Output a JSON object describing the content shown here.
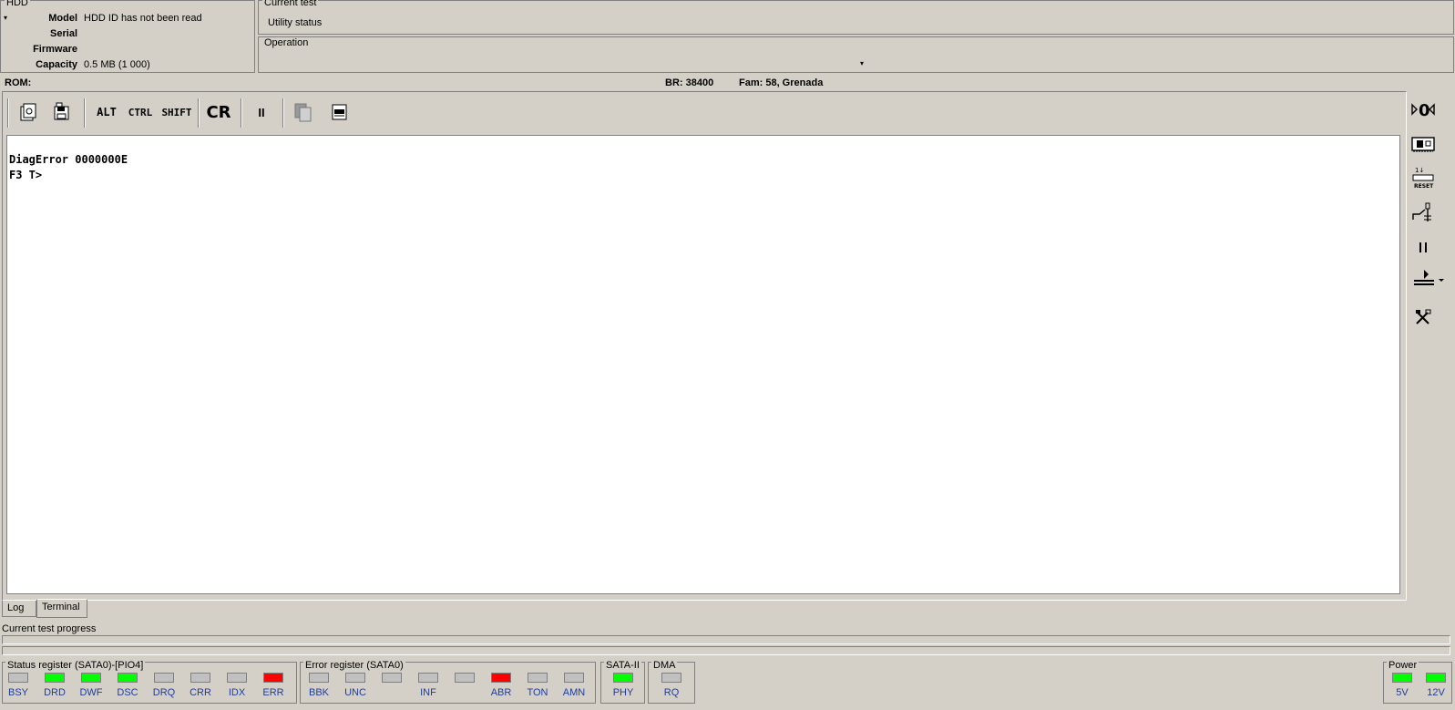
{
  "hdd": {
    "group_title": "HDD",
    "model_label": "Model",
    "model_value": "HDD ID has not been read",
    "serial_label": "Serial",
    "serial_value": "",
    "firmware_label": "Firmware",
    "firmware_value": "",
    "capacity_label": "Capacity",
    "capacity_value": "0.5 MB (1 000)"
  },
  "current_test": {
    "title": "Current test",
    "value": "Utility status"
  },
  "operation": {
    "title": "Operation",
    "value": ""
  },
  "infobar": {
    "rom": "ROM:",
    "br": "BR: 38400",
    "fam": "Fam: 58, Grenada"
  },
  "toolbar": {
    "alt": "ALT",
    "ctrl": "CTRL",
    "shift": "SHIFT",
    "cr": "CR",
    "pause": "II"
  },
  "terminal": {
    "lines": [
      "DiagError 0000000E",
      "F3 T>"
    ]
  },
  "tabs": {
    "log": "Log",
    "terminal": "Terminal"
  },
  "progress": {
    "label": "Current test progress",
    "value": 0
  },
  "status_register": {
    "title": "Status register (SATA0)-[PIO4]",
    "leds": [
      {
        "name": "BSY",
        "color": "#c0c0c0"
      },
      {
        "name": "DRD",
        "color": "#00ff00"
      },
      {
        "name": "DWF",
        "color": "#00ff00"
      },
      {
        "name": "DSC",
        "color": "#00ff00"
      },
      {
        "name": "DRQ",
        "color": "#c0c0c0"
      },
      {
        "name": "CRR",
        "color": "#c0c0c0"
      },
      {
        "name": "IDX",
        "color": "#c0c0c0"
      },
      {
        "name": "ERR",
        "color": "#ff0000"
      }
    ]
  },
  "error_register": {
    "title": "Error register (SATA0)",
    "leds": [
      {
        "name": "BBK",
        "color": "#c0c0c0"
      },
      {
        "name": "UNC",
        "color": "#c0c0c0"
      },
      {
        "name": "",
        "color": "#c0c0c0"
      },
      {
        "name": "INF",
        "color": "#c0c0c0"
      },
      {
        "name": "",
        "color": "#c0c0c0"
      },
      {
        "name": "ABR",
        "color": "#ff0000"
      },
      {
        "name": "TON",
        "color": "#c0c0c0"
      },
      {
        "name": "AMN",
        "color": "#c0c0c0"
      }
    ]
  },
  "sata": {
    "title": "SATA-II",
    "led": {
      "name": "PHY",
      "color": "#00ff00"
    }
  },
  "dma": {
    "title": "DMA",
    "led": {
      "name": "RQ",
      "color": "#c0c0c0"
    }
  },
  "power": {
    "title": "Power",
    "leds": [
      {
        "name": "5V",
        "color": "#00ff00"
      },
      {
        "name": "12V",
        "color": "#00ff00"
      }
    ]
  },
  "side_icons": [
    "zero-speed-icon",
    "board-icon",
    "reset-icon",
    "power-switch-icon",
    "pause-icon",
    "play-menu-icon",
    "tools-icon"
  ]
}
